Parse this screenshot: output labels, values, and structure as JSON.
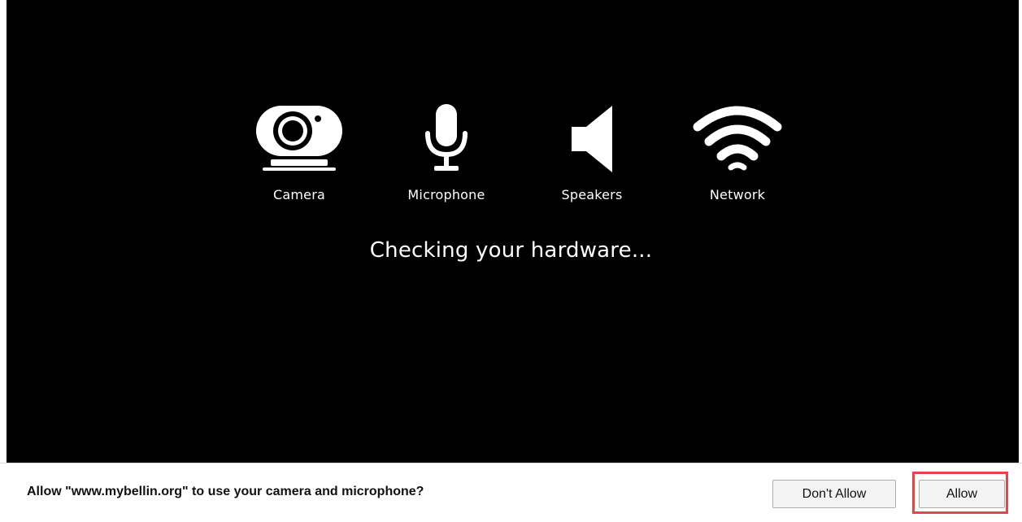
{
  "devices": [
    {
      "label": "Camera",
      "icon": "camera-icon"
    },
    {
      "label": "Microphone",
      "icon": "microphone-icon"
    },
    {
      "label": "Speakers",
      "icon": "speaker-icon"
    },
    {
      "label": "Network",
      "icon": "wifi-icon"
    }
  ],
  "status_text": "Checking your hardware...",
  "prompt": {
    "text": "Allow \"www.mybellin.org\" to use your camera and microphone?",
    "deny_label": "Don't Allow",
    "allow_label": "Allow"
  },
  "colors": {
    "background": "#000000",
    "icon": "#ffffff",
    "highlight": "#e8444a"
  }
}
